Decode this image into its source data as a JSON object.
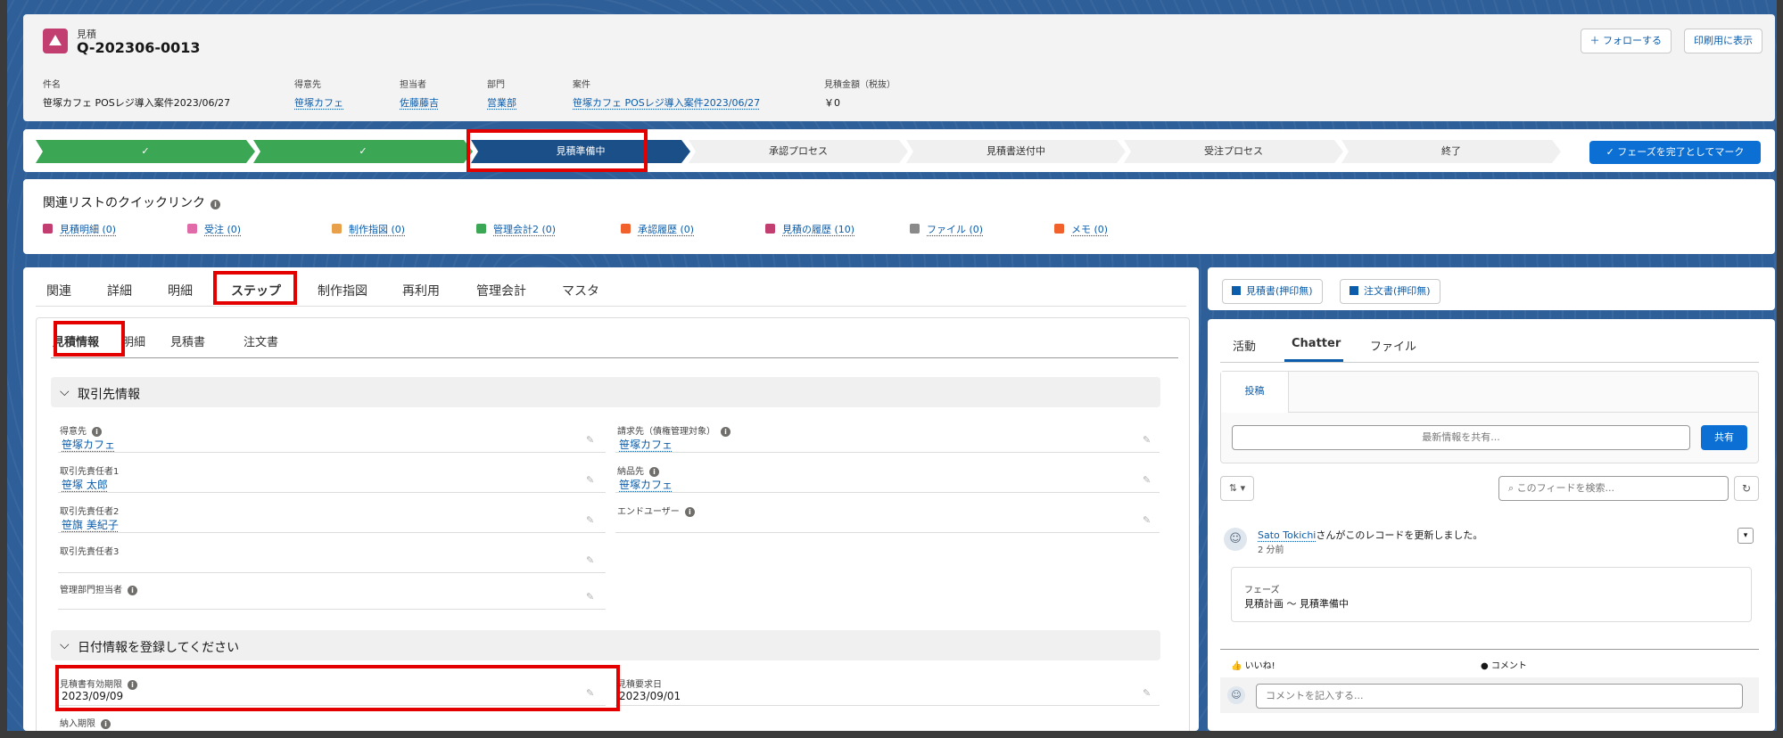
{
  "header": {
    "object_type": "見積",
    "record_name": "Q-202306-0013",
    "follow_label": "フォローする",
    "print_label": "印刷用に表示",
    "fields": [
      {
        "label": "件名",
        "value": "笹塚カフェ POSレジ導入案件2023/06/27",
        "link": false
      },
      {
        "label": "得意先",
        "value": "笹塚カフェ",
        "link": true
      },
      {
        "label": "担当者",
        "value": "佐藤藤吉",
        "link": true
      },
      {
        "label": "部門",
        "value": "営業部",
        "link": true
      },
      {
        "label": "案件",
        "value": "笹塚カフェ POSレジ導入案件2023/06/27",
        "link": true
      },
      {
        "label": "見積金額（税抜）",
        "value": "￥0",
        "link": false
      }
    ]
  },
  "path": {
    "stages": [
      "✓",
      "✓",
      "見積準備中",
      "承認プロセス",
      "見積書送付中",
      "受注プロセス",
      "終了"
    ],
    "current_index": 2,
    "mark_complete_label": "フェーズを完了としてマーク"
  },
  "quick_links": {
    "title": "関連リストのクイックリンク",
    "items": [
      {
        "label": "見積明細 (0)",
        "color": "#c23d70"
      },
      {
        "label": "受注 (0)",
        "color": "#e16aa8"
      },
      {
        "label": "制作指図 (0)",
        "color": "#e8a04a"
      },
      {
        "label": "管理会計2 (0)",
        "color": "#3ba755"
      },
      {
        "label": "承認履歴 (0)",
        "color": "#f0612c"
      },
      {
        "label": "見積の履歴 (10)",
        "color": "#c23d70"
      },
      {
        "label": "ファイル (0)",
        "color": "#8a8a8a"
      },
      {
        "label": "メモ (0)",
        "color": "#f0612c"
      }
    ]
  },
  "main_tabs": [
    "関連",
    "詳細",
    "明細",
    "ステップ",
    "制作指図",
    "再利用",
    "管理会計",
    "マスタ"
  ],
  "active_main_tab": "ステップ",
  "sub_tabs": [
    "見積情報",
    "明細",
    "見積書",
    "注文書"
  ],
  "active_sub_tab": "見積情報",
  "section_client": {
    "title": "取引先情報",
    "left": [
      {
        "label": "得意先",
        "value": "笹塚カフェ",
        "link": true,
        "info": true
      },
      {
        "label": "取引先責任者1",
        "value": "笹塚 太郎",
        "link": true,
        "info": false
      },
      {
        "label": "取引先責任者2",
        "value": "笹旗 美紀子",
        "link": true,
        "info": false
      },
      {
        "label": "取引先責任者3",
        "value": "",
        "link": false,
        "info": false
      },
      {
        "label": "管理部門担当者",
        "value": "",
        "link": false,
        "info": true
      }
    ],
    "right": [
      {
        "label": "請求先（債権管理対象）",
        "value": "笹塚カフェ",
        "link": true,
        "info": true
      },
      {
        "label": "納品先",
        "value": "笹塚カフェ",
        "link": true,
        "info": true
      },
      {
        "label": "エンドユーザー",
        "value": "",
        "link": false,
        "info": true
      }
    ]
  },
  "section_date": {
    "title": "日付情報を登録してください",
    "left": [
      {
        "label": "見積書有効期限",
        "value": "2023/09/09",
        "info": true
      },
      {
        "label": "納入期限",
        "value": "",
        "info": true
      }
    ],
    "right": [
      {
        "label": "見積要求日",
        "value": "2023/09/01",
        "info": false
      }
    ]
  },
  "right_panel": {
    "buttons": [
      "見積書(押印無)",
      "注文書(押印無)"
    ],
    "tabs": [
      "活動",
      "Chatter",
      "ファイル"
    ],
    "active_tab": "Chatter",
    "post_tab": "投稿",
    "share_placeholder": "最新情報を共有...",
    "share_button": "共有",
    "feed_search_placeholder": "このフィードを検索...",
    "feed": {
      "user": "Sato Tokichi",
      "action": "さんがこのレコードを更新しました。",
      "time": "2 分前",
      "change_field": "フェーズ",
      "change_value": "見積計画 〜 見積準備中",
      "like": "いいね!",
      "comment": "コメント",
      "comment_placeholder": "コメントを記入する..."
    }
  },
  "colors": {
    "accent": "#0b5cab",
    "path_done": "#3ba755",
    "path_current": "#1b4f87",
    "highlight": "#e50000"
  }
}
